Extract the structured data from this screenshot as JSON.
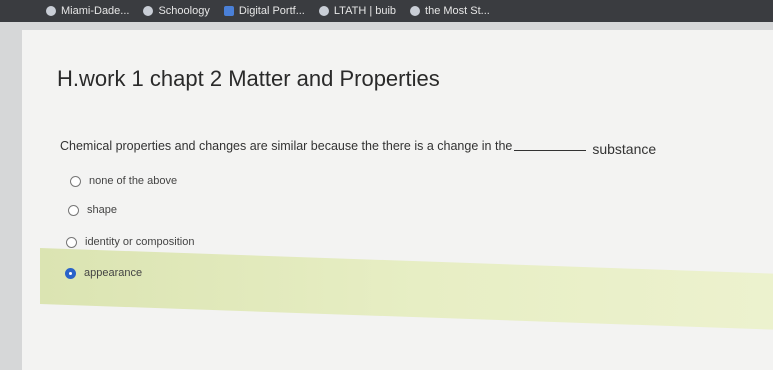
{
  "bookmarks": [
    {
      "label": "Miami-Dade...",
      "icon": "globe-icon"
    },
    {
      "label": "Schoology",
      "icon": "schoology-icon"
    },
    {
      "label": "Digital Portf...",
      "icon": "portfolio-icon"
    },
    {
      "label": "LTATH | buib",
      "icon": "bookmark-icon"
    },
    {
      "label": "the Most St...",
      "icon": "bookmark-icon"
    }
  ],
  "assignment": {
    "title": "H.work 1 chapt 2 Matter and Properties"
  },
  "question": {
    "text_before": "Chemical properties and changes are similar because the there is a change in the",
    "text_after": "substance"
  },
  "choices": [
    {
      "label": "none of the above",
      "selected": false
    },
    {
      "label": "shape",
      "selected": false
    },
    {
      "label": "identity or composition",
      "selected": false
    },
    {
      "label": "appearance",
      "selected": true
    }
  ],
  "colors": {
    "selected_radio": "#2a63c9",
    "highlight": "#e7eec4"
  }
}
